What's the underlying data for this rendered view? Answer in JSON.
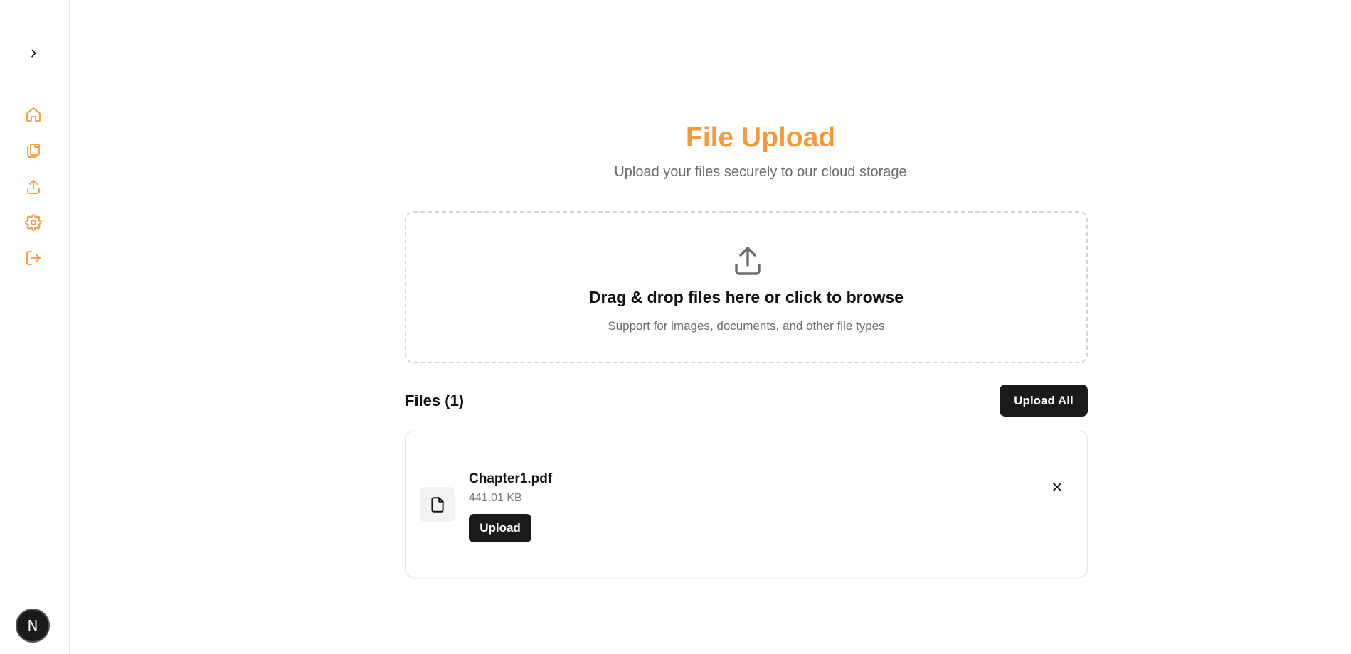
{
  "colors": {
    "accent": "#f5993d",
    "dark_button": "#1a1a1a",
    "muted_text": "#6b6b6b"
  },
  "sidebar": {
    "toggle_icon": "chevron-right-icon",
    "items": [
      {
        "icon": "home-icon"
      },
      {
        "icon": "files-icon"
      },
      {
        "icon": "upload-icon"
      },
      {
        "icon": "gear-icon"
      },
      {
        "icon": "logout-icon"
      }
    ],
    "avatar_letter": "N"
  },
  "header": {
    "title": "File Upload",
    "subtitle": "Upload your files securely to our cloud storage"
  },
  "dropzone": {
    "icon": "upload-icon",
    "title": "Drag & drop files here or click to browse",
    "subtitle": "Support for images, documents, and other file types"
  },
  "files": {
    "heading": "Files (1)",
    "upload_all_label": "Upload All",
    "items": [
      {
        "icon": "file-icon",
        "name": "Chapter1.pdf",
        "size": "441.01 KB",
        "upload_label": "Upload"
      }
    ]
  }
}
